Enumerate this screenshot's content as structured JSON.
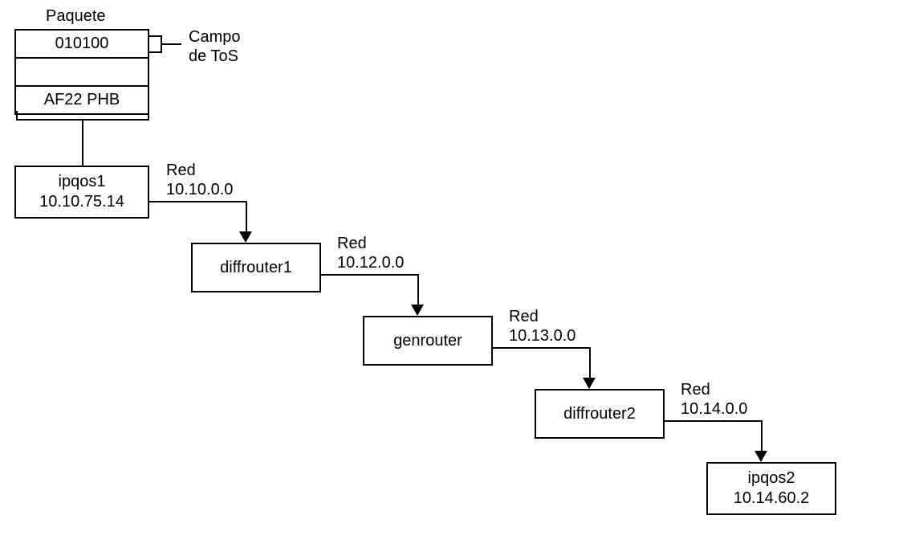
{
  "packet": {
    "title": "Paquete",
    "rows": {
      "tos_bits": "010100",
      "blank": "",
      "phb": "AF22 PHB"
    },
    "tos_label_line1": "Campo",
    "tos_label_line2": "de ToS"
  },
  "nodes": {
    "ipqos1": {
      "name": "ipqos1",
      "ip": "10.10.75.14"
    },
    "diffrouter1": {
      "name": "diffrouter1"
    },
    "genrouter": {
      "name": "genrouter"
    },
    "diffrouter2": {
      "name": "diffrouter2"
    },
    "ipqos2": {
      "name": "ipqos2",
      "ip": "10.14.60.2"
    }
  },
  "links": {
    "l1": {
      "label": "Red",
      "net": "10.10.0.0"
    },
    "l2": {
      "label": "Red",
      "net": "10.12.0.0"
    },
    "l3": {
      "label": "Red",
      "net": "10.13.0.0"
    },
    "l4": {
      "label": "Red",
      "net": "10.14.0.0"
    }
  },
  "chart_data": {
    "type": "table",
    "description": "Network packet with DSCP bits 010100 / PHB AF22 originating at host ipqos1 (10.10.75.14), traversing networks 10.10.0.0 → diffrouter1 → 10.12.0.0 → genrouter → 10.13.0.0 → diffrouter2 → 10.14.0.0 → ipqos2 (10.14.60.2).",
    "packet": {
      "dscp_bits": "010100",
      "phb": "AF22"
    },
    "path": [
      {
        "node": "ipqos1",
        "ip": "10.10.75.14"
      },
      {
        "link_network": "10.10.0.0"
      },
      {
        "node": "diffrouter1"
      },
      {
        "link_network": "10.12.0.0"
      },
      {
        "node": "genrouter"
      },
      {
        "link_network": "10.13.0.0"
      },
      {
        "node": "diffrouter2"
      },
      {
        "link_network": "10.14.0.0"
      },
      {
        "node": "ipqos2",
        "ip": "10.14.60.2"
      }
    ]
  }
}
